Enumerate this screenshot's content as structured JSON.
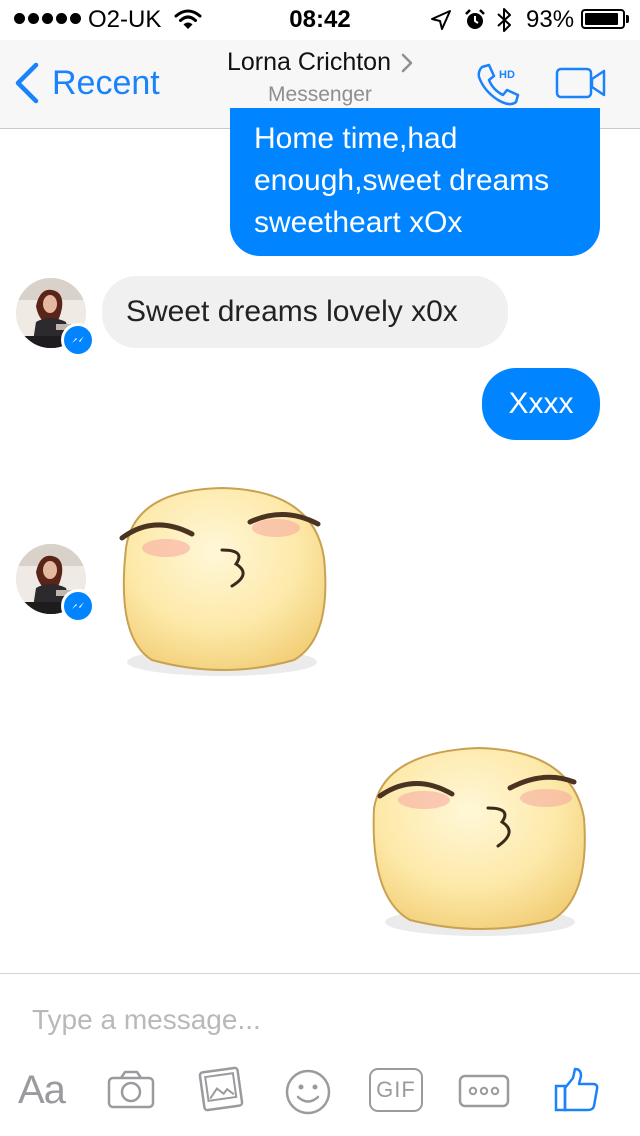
{
  "status_bar": {
    "carrier": "O2-UK",
    "time": "08:42",
    "battery_percent": "93%",
    "battery_level": 0.93,
    "signal_bars": 5,
    "icons": [
      "signal-dots-icon",
      "wifi-icon",
      "location-arrow-icon",
      "alarm-icon",
      "bluetooth-icon",
      "battery-icon"
    ]
  },
  "nav": {
    "back_label": "Recent",
    "contact_name": "Lorna Crichton",
    "contact_subtitle": "Messenger",
    "call_badge": "HD",
    "accent_color": "#1a82fb",
    "icons": [
      "chevron-left-icon",
      "chevron-right-icon",
      "phone-hd-icon",
      "video-camera-icon"
    ]
  },
  "conversation": {
    "messages": [
      {
        "direction": "outgoing",
        "type": "text",
        "text": "Home time,had enough,sweet dreams sweetheart xOx"
      },
      {
        "direction": "incoming",
        "type": "text",
        "text": "Sweet dreams lovely x0x"
      },
      {
        "direction": "outgoing",
        "type": "text",
        "text": "Xxxx"
      },
      {
        "direction": "incoming",
        "type": "sticker",
        "sticker": "kissing-face-sticker"
      },
      {
        "direction": "outgoing",
        "type": "sticker",
        "sticker": "kissing-face-sticker"
      }
    ],
    "outgoing_color": "#0084ff",
    "incoming_color": "#f1f0f0"
  },
  "composer": {
    "placeholder": "Type a message...",
    "value": "",
    "tools": {
      "text_style": "Aa",
      "gif": "GIF",
      "icons": [
        "camera-icon",
        "photo-gallery-icon",
        "emoji-icon",
        "gif-icon",
        "more-icon",
        "like-icon"
      ]
    }
  }
}
